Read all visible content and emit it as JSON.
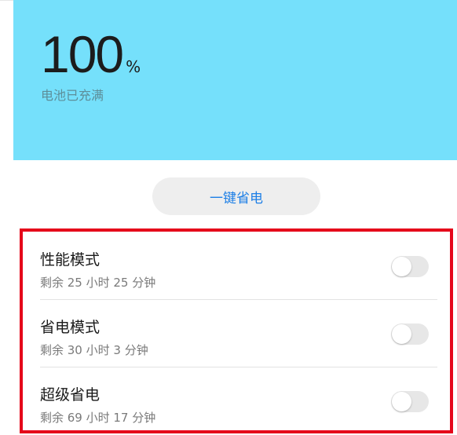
{
  "battery": {
    "level": "100",
    "unit": "%",
    "status": "电池已充满"
  },
  "actions": {
    "one_key_save": "一键省电"
  },
  "modes": [
    {
      "name": "性能模式",
      "remaining": "剩余 25 小时 25 分钟",
      "enabled": false
    },
    {
      "name": "省电模式",
      "remaining": "剩余 30 小时 3 分钟",
      "enabled": false
    },
    {
      "name": "超级省电",
      "remaining": "剩余 69 小时 17 分钟",
      "enabled": false
    }
  ],
  "colors": {
    "battery_panel": "#75e0fb",
    "accent": "#1d7fe6",
    "highlight_border": "#e5051a"
  }
}
